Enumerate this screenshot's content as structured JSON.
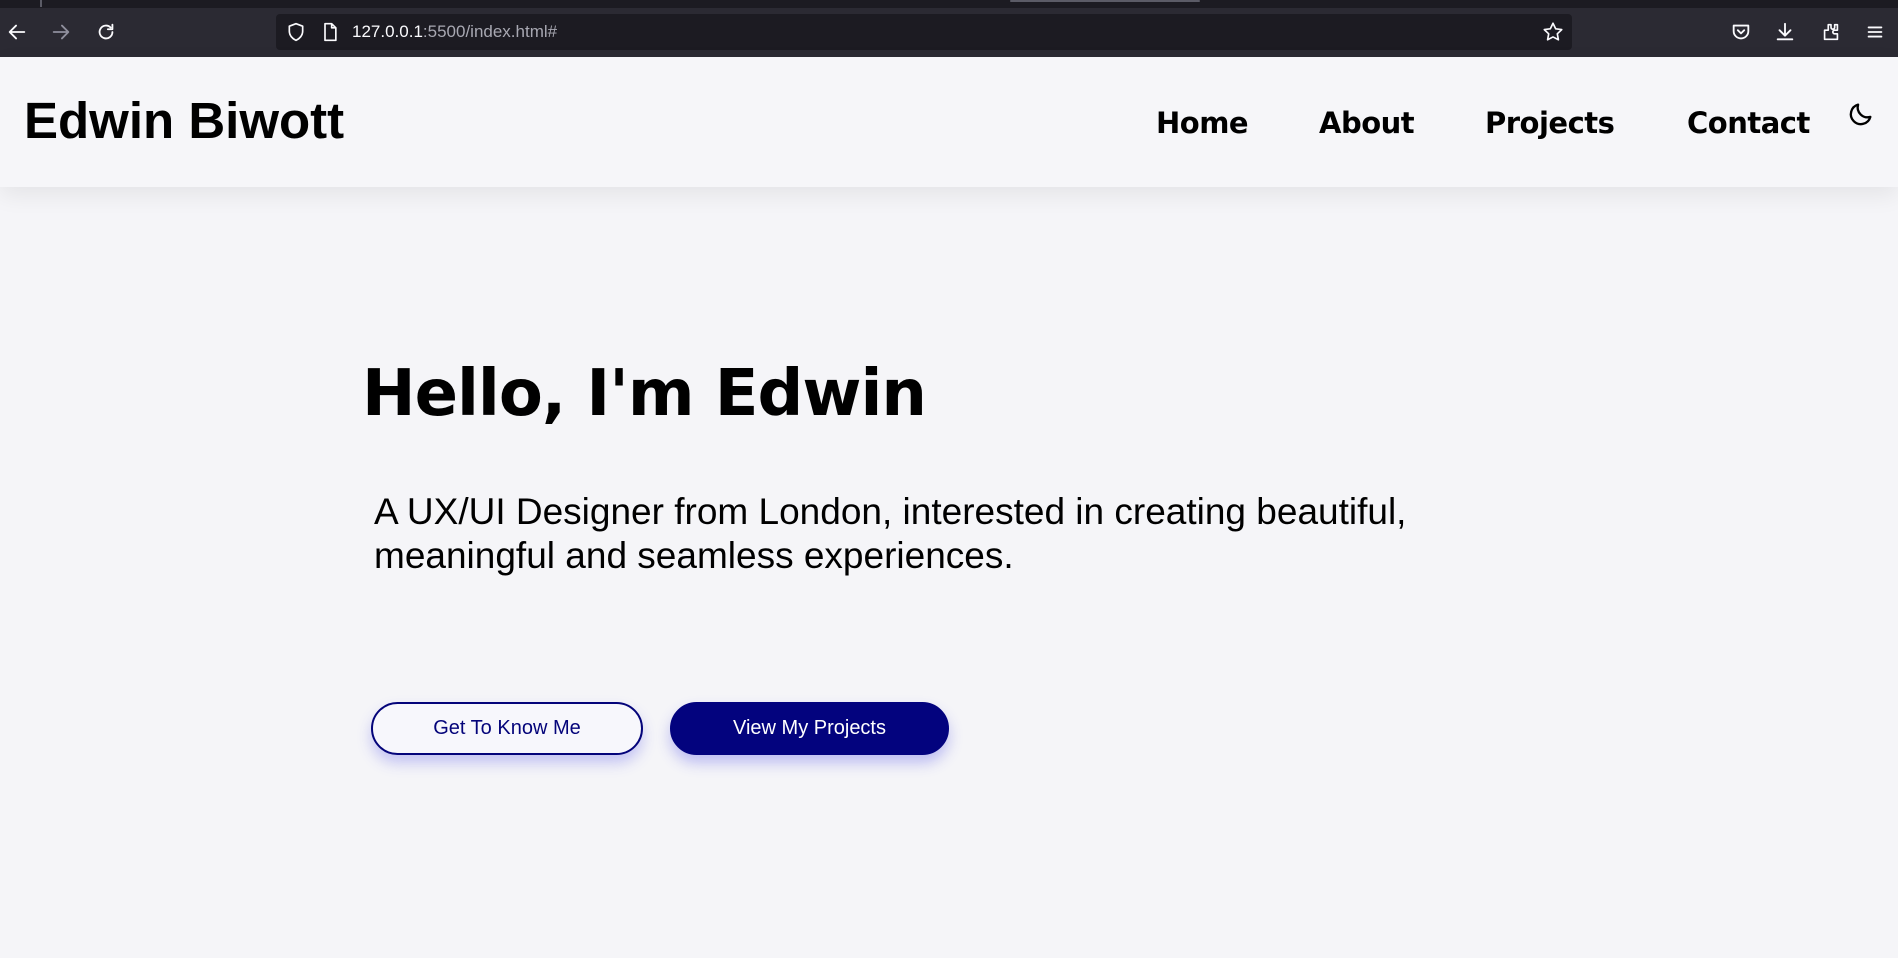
{
  "browser": {
    "url_host": "127.0.0.1",
    "url_rest": ":5500/index.html#",
    "icons": [
      "back-arrow-icon",
      "forward-arrow-icon",
      "reload-icon",
      "shield-icon",
      "page-icon",
      "star-icon",
      "pocket-icon",
      "download-icon",
      "extensions-icon",
      "menu-icon"
    ]
  },
  "header": {
    "logo": "Edwin Biwott",
    "nav": [
      "Home",
      "About",
      "Projects",
      "Contact"
    ],
    "theme_icon": "moon-icon"
  },
  "hero": {
    "title": "Hello, I'm Edwin",
    "subtitle": "A UX/UI Designer from London, interested in creating beautiful, meaningful and seamless experiences.",
    "buttons": {
      "primary": "Get To Know Me",
      "secondary": "View My Projects"
    }
  },
  "colors": {
    "accent": "#03037e",
    "page_background": "#f5f5f8",
    "browser_chrome": "#2b2a33"
  }
}
